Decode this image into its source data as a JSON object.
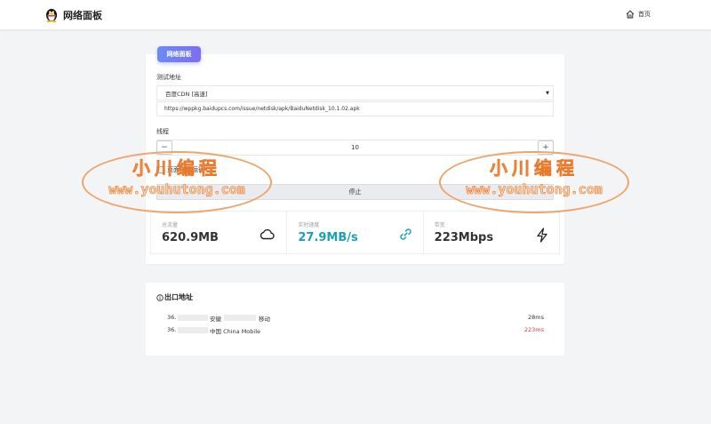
{
  "header": {
    "brand": "网络面板",
    "home_label": "首页"
  },
  "panel": {
    "tab_label": "网络面板",
    "test_address_label": "测试地址",
    "selected_source": "百度CDN [高速]",
    "url": "https://wppkg.baidupcs.com/issue/netdisk/apk/BaiduNetdisk_10.1.02.apk",
    "threads_label": "线程",
    "threads_value": "10",
    "minus_symbol": "−",
    "plus_symbol": "+",
    "auto_run_label": "页面自动运行",
    "stop_label": "停止"
  },
  "stats": [
    {
      "label": "总流量",
      "value": "620.9MB",
      "icon": "cloud-icon"
    },
    {
      "label": "实时速度",
      "value": "27.9MB/s",
      "icon": "link-icon"
    },
    {
      "label": "带宽",
      "value": "223Mbps",
      "icon": "lightning-icon"
    }
  ],
  "exit": {
    "title": "出口地址",
    "rows": [
      {
        "ip_prefix": "36.",
        "region": "安徽",
        "isp": "移动",
        "latency": "28ms"
      },
      {
        "ip_prefix": "36.",
        "region": "中国 China Mobile",
        "latency": "223ms"
      }
    ]
  },
  "watermark": {
    "line1": "小川编程",
    "line2": "www.youhutong.com"
  },
  "colors": {
    "accent": "#6f7ff0",
    "teal": "#17a2b8",
    "latency_high": "#e53935",
    "watermark": "#e9792a"
  }
}
